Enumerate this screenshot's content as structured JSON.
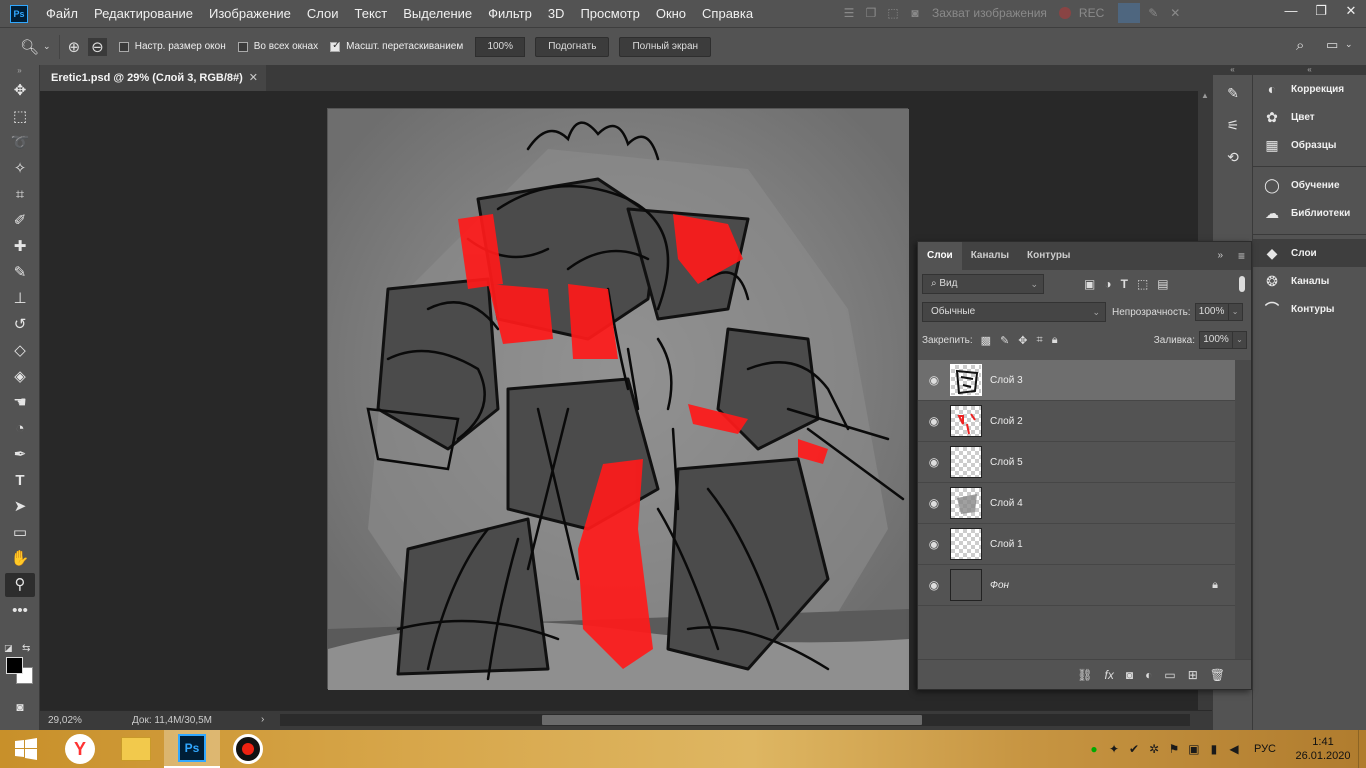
{
  "app": {
    "logo": "Ps"
  },
  "menu": [
    "Файл",
    "Редактирование",
    "Изображение",
    "Слои",
    "Текст",
    "Выделение",
    "Фильтр",
    "3D",
    "Просмотр",
    "Окно",
    "Справка"
  ],
  "capture": {
    "label": "Захват изображения",
    "rec": "REC"
  },
  "options": {
    "resize_windows": "Настр. размер окон",
    "all_windows": "Во всех окнах",
    "scrubby_zoom": "Масшт. перетаскиванием",
    "zoom_value": "100%",
    "fit_button": "Подогнать",
    "fullscreen_button": "Полный экран"
  },
  "document": {
    "tab_title": "Eretic1.psd @ 29% (Слой 3, RGB/8#)"
  },
  "status": {
    "zoom": "29,02%",
    "doc": "Док: 11,4M/30,5M"
  },
  "right_panels": {
    "group1": [
      "Коррекция",
      "Цвет",
      "Образцы"
    ],
    "group2": [
      "Обучение",
      "Библиотеки"
    ],
    "group3": [
      "Слои",
      "Каналы",
      "Контуры"
    ]
  },
  "layers_panel": {
    "tabs": [
      "Слои",
      "Каналы",
      "Контуры"
    ],
    "filter_label": "Вид",
    "blend_mode": "Обычные",
    "opacity_label": "Непрозрачность:",
    "opacity_value": "100%",
    "lock_label": "Закрепить:",
    "fill_label": "Заливка:",
    "fill_value": "100%",
    "layers": [
      {
        "name": "Слой 3",
        "selected": true
      },
      {
        "name": "Слой 2",
        "selected": false
      },
      {
        "name": "Слой 5",
        "selected": false
      },
      {
        "name": "Слой 4",
        "selected": false
      },
      {
        "name": "Слой 1",
        "selected": false
      },
      {
        "name": "Фон",
        "selected": false,
        "locked": true
      }
    ]
  },
  "taskbar": {
    "lang": "РУС",
    "time": "1:41",
    "date": "26.01.2020"
  },
  "colors": {
    "accent_red": "#ff1a1a",
    "ps_blue": "#31a8ff"
  }
}
